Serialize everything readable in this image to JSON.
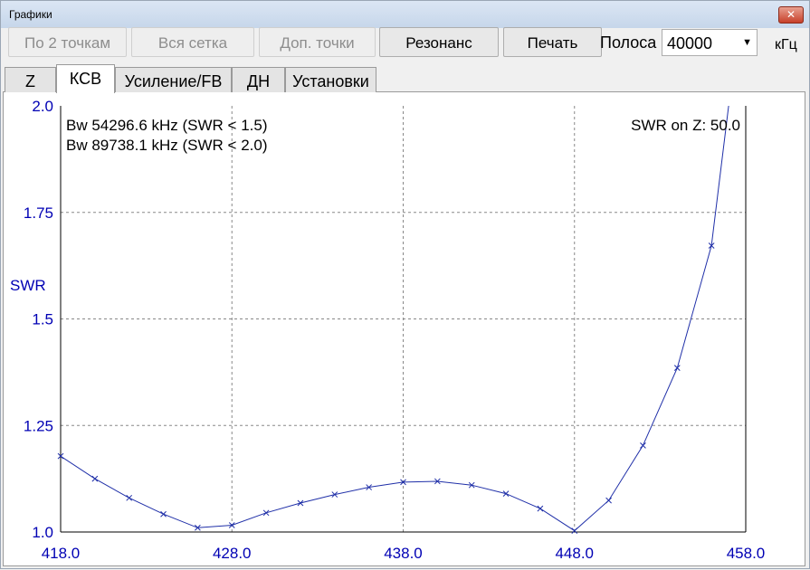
{
  "window": {
    "title": "Графики",
    "close_glyph": "✕"
  },
  "toolbar": {
    "buttons": [
      {
        "label": "По 2 точкам",
        "enabled": false
      },
      {
        "label": "Вся сетка",
        "enabled": false
      },
      {
        "label": "Доп. точки",
        "enabled": false
      },
      {
        "label": "Резонанс",
        "enabled": true
      },
      {
        "label": "Печать",
        "enabled": true
      }
    ],
    "band_label": "Полоса",
    "band_value": "40000",
    "band_unit": "кГц"
  },
  "tabs": [
    {
      "label": "Z",
      "active": false
    },
    {
      "label": "КСВ",
      "active": true
    },
    {
      "label": "Усиление/FB",
      "active": false
    },
    {
      "label": "ДН",
      "active": false
    },
    {
      "label": "Установки",
      "active": false
    }
  ],
  "chart_data": {
    "type": "line",
    "ylabel": "SWR",
    "xlim": [
      418.0,
      458.0
    ],
    "ylim": [
      1.0,
      2.0
    ],
    "x_ticks": [
      "418.0",
      "428.0",
      "438.0",
      "448.0",
      "458.0"
    ],
    "y_ticks": [
      "1.0",
      "1.25",
      "1.5",
      "1.75",
      "2.0"
    ],
    "grid": true,
    "annotations": {
      "bw_1": "Bw 54296.6 kHz (SWR < 1.5)",
      "bw_2": "Bw 89738.1 kHz (SWR < 2.0)",
      "swr_on_z": "SWR on Z: 50.0"
    },
    "series": [
      {
        "color": "#1f2fa8",
        "x": [
          418.0,
          420.0,
          422.0,
          424.0,
          426.0,
          428.0,
          430.0,
          432.0,
          434.0,
          436.0,
          438.0,
          440.0,
          442.0,
          444.0,
          446.0,
          448.0,
          450.0,
          452.0,
          454.0,
          456.0,
          457.0
        ],
        "y": [
          1.178,
          1.125,
          1.08,
          1.042,
          1.01,
          1.016,
          1.045,
          1.068,
          1.088,
          1.105,
          1.117,
          1.119,
          1.11,
          1.09,
          1.055,
          1.003,
          1.074,
          1.203,
          1.385,
          1.672,
          2.0
        ]
      }
    ]
  },
  "colors": {
    "axis_text": "#0000b4",
    "line": "#1f2fa8",
    "grid": "#888888",
    "tab_panel": "#ffffff"
  }
}
